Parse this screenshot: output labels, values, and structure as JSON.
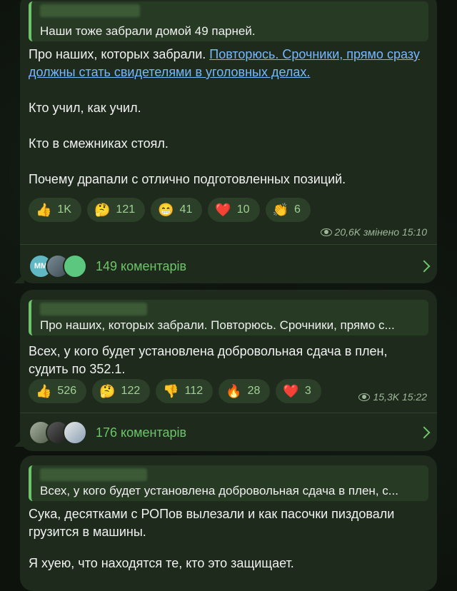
{
  "messages": [
    {
      "quote_text": "Наши тоже забрали домой 49 парней.",
      "text_prefix": "Про наших, которых забрали. ",
      "text_link": "Повторюсь. Срочники, прямо сразу должны стать свидетелями в уголовных делах.",
      "paragraphs": [
        "Кто учил, как учил.",
        "Кто в смежниках стоял.",
        "Почему драпали с отлично подготовленных позиций."
      ],
      "reactions": [
        {
          "emoji": "👍",
          "count": "1K"
        },
        {
          "emoji": "🤔",
          "count": "121"
        },
        {
          "emoji": "😁",
          "count": "41"
        },
        {
          "emoji": "❤️",
          "count": "10"
        },
        {
          "emoji": "👏",
          "count": "6"
        }
      ],
      "meta": "20,6K змінено 15:10",
      "comments_label": "149 коментарів",
      "avatar_initials": "ММ"
    },
    {
      "quote_text": "Про наших, которых забрали. Повторюсь.   Срочники, прямо с...",
      "text": "Всех, у кого будет установлена добровольная сдача в плен, судить по 352.1.",
      "reactions": [
        {
          "emoji": "👍",
          "count": "526"
        },
        {
          "emoji": "🤔",
          "count": "122"
        },
        {
          "emoji": "👎",
          "count": "112"
        },
        {
          "emoji": "🔥",
          "count": "28"
        },
        {
          "emoji": "❤️",
          "count": "3"
        }
      ],
      "meta": "15,3K 15:22",
      "comments_label": "176 коментарів"
    },
    {
      "quote_text": "Всех, у кого будет установлена добровольная сдача в плен, с...",
      "text": "Сука, десятками с РОПов вылезали и как пасочки пиздовали грузится в машины.",
      "text2": "Я хуею, что находятся те, кто это защищает."
    }
  ]
}
